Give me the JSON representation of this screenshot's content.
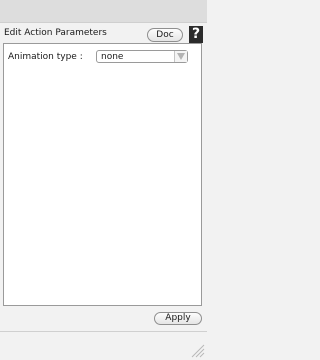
{
  "header": {
    "title": "Edit Action Parameters",
    "doc_label": "Doc",
    "help_label": "?"
  },
  "form": {
    "animation_type": {
      "label": "Animation type :",
      "value": "none"
    }
  },
  "footer": {
    "apply_label": "Apply"
  },
  "icons": {
    "help": "question-mark-icon",
    "select_arrow": "chevron-down-icon",
    "resize": "resize-grip-icon"
  }
}
